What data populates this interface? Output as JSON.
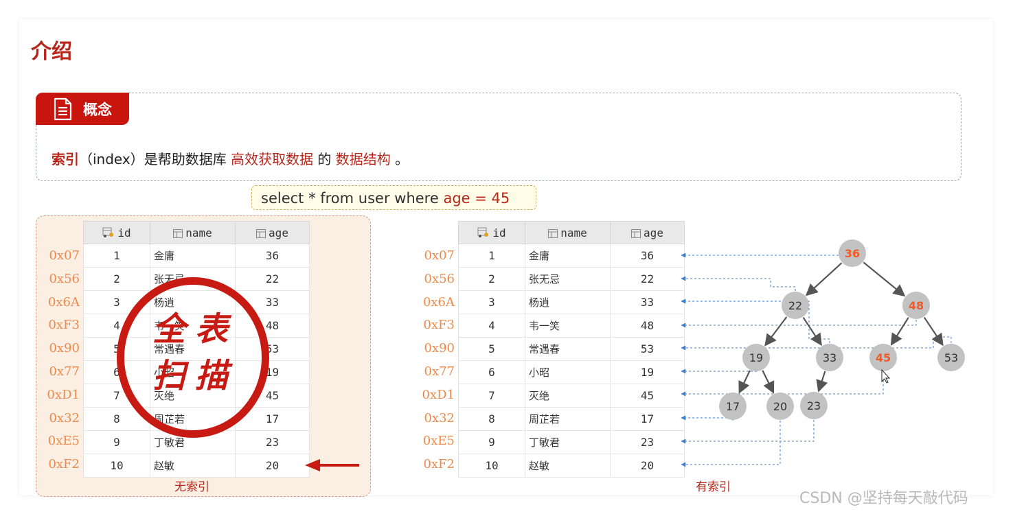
{
  "title": "介绍",
  "concept": {
    "tag": "概念",
    "def": [
      "索引",
      "（index）是帮助数据库 ",
      "高效获取数据",
      " 的 ",
      "数据结构",
      " 。"
    ]
  },
  "sql": {
    "prefix": "select * from user where ",
    "cond": "age = 45"
  },
  "headers": {
    "id": "id",
    "name": "name",
    "age": "age"
  },
  "rows": [
    {
      "addr": "0x07",
      "id": "1",
      "name": "金庸",
      "age": "36"
    },
    {
      "addr": "0x56",
      "id": "2",
      "name": "张无忌",
      "age": "22"
    },
    {
      "addr": "0x6A",
      "id": "3",
      "name": "杨逍",
      "age": "33"
    },
    {
      "addr": "0xF3",
      "id": "4",
      "name": "韦一笑",
      "age": "48"
    },
    {
      "addr": "0x90",
      "id": "5",
      "name": "常遇春",
      "age": "53"
    },
    {
      "addr": "0x77",
      "id": "6",
      "name": "小昭",
      "age": "19"
    },
    {
      "addr": "0xD1",
      "id": "7",
      "name": "灭绝",
      "age": "45"
    },
    {
      "addr": "0x32",
      "id": "8",
      "name": "周芷若",
      "age": "17"
    },
    {
      "addr": "0xE5",
      "id": "9",
      "name": "丁敏君",
      "age": "23"
    },
    {
      "addr": "0xF2",
      "id": "10",
      "name": "赵敏",
      "age": "20"
    }
  ],
  "stamp": {
    "line1": "全表",
    "line2": "扫描"
  },
  "captions": {
    "left": "无索引",
    "right": "有索引"
  },
  "tree_nodes": [
    "36",
    "22",
    "48",
    "19",
    "33",
    "45",
    "53",
    "17",
    "20",
    "23"
  ],
  "highlight_color": "#f05a28",
  "watermark": "CSDN @坚持每天敲代码"
}
